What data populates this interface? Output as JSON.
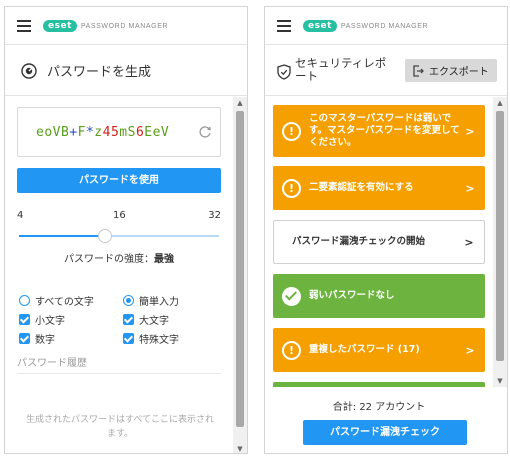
{
  "left": {
    "brand": {
      "logo": "eset",
      "name": "PASSWORD MANAGER"
    },
    "title": "パスワードを生成",
    "password": [
      {
        "c": "e",
        "k": "l"
      },
      {
        "c": "o",
        "k": "l"
      },
      {
        "c": "V",
        "k": "u"
      },
      {
        "c": "B",
        "k": "u"
      },
      {
        "c": "+",
        "k": "s"
      },
      {
        "c": "F",
        "k": "u"
      },
      {
        "c": "*",
        "k": "s"
      },
      {
        "c": "z",
        "k": "l"
      },
      {
        "c": "4",
        "k": "d"
      },
      {
        "c": "5",
        "k": "d"
      },
      {
        "c": "m",
        "k": "l"
      },
      {
        "c": "S",
        "k": "u"
      },
      {
        "c": "6",
        "k": "d"
      },
      {
        "c": "E",
        "k": "u"
      },
      {
        "c": "e",
        "k": "l"
      },
      {
        "c": "V",
        "k": "u"
      }
    ],
    "use_button": "パスワードを使用",
    "length": {
      "min": "4",
      "value": "16",
      "max": "32",
      "min_num": 4,
      "value_num": 16,
      "max_num": 32
    },
    "strength_label": "パスワードの強度：",
    "strength_value": "最強",
    "options": {
      "all_chars": "すべての文字",
      "easy_input": "簡単入力",
      "lowercase": "小文字",
      "uppercase": "大文字",
      "numbers": "数字",
      "special": "特殊文字"
    },
    "history_title": "パスワード履歴",
    "history_empty": "生成されたパスワードはすべてここに表示されます。"
  },
  "right": {
    "brand": {
      "logo": "eset",
      "name": "PASSWORD MANAGER"
    },
    "title": "セキュリティレポート",
    "export_label": "エクスポート",
    "cards": [
      {
        "type": "warning",
        "text": "このマスターパスワードは弱いです。マスターパスワードを変更してください。"
      },
      {
        "type": "warning",
        "text": "二要素認証を有効にする"
      },
      {
        "type": "action",
        "text": "パスワード漏洩チェックの開始"
      },
      {
        "type": "ok",
        "text": "弱いパスワードなし"
      },
      {
        "type": "warning",
        "text": "重複したパスワード (17)"
      }
    ],
    "total": "合計: 22 アカウント",
    "breach_button": "パスワード漏洩チェック"
  },
  "colors": {
    "accent": "#2196f3",
    "warning": "#f5a000",
    "ok": "#6cb43f",
    "brand": "#26bfa2"
  }
}
